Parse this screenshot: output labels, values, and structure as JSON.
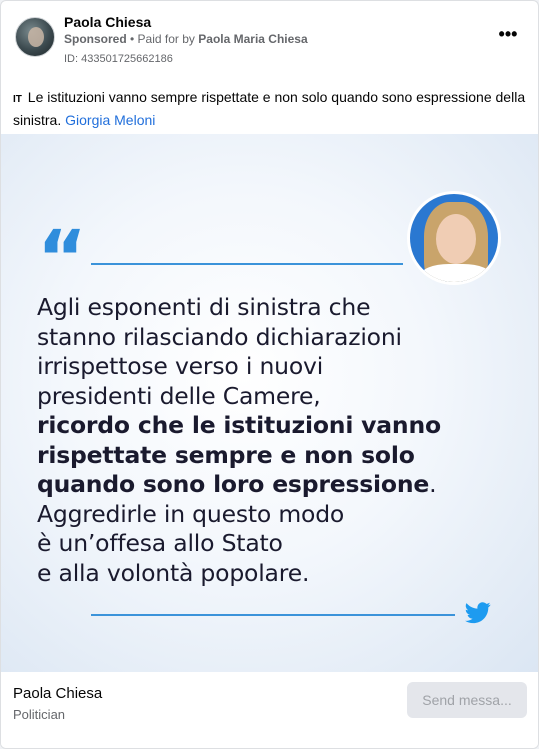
{
  "header": {
    "page_name": "Paola Chiesa",
    "sponsored_label": "Sponsored",
    "separator": " • ",
    "paid_for_text": "Paid for by",
    "payer_name": "Paola Maria Chiesa",
    "ad_id": "ID: 433501725662186",
    "more_label": "•••"
  },
  "caption": {
    "flag": "IT",
    "text": " Le istituzioni vanno sempre rispettate e non solo quando sono espressione della sinistra. ",
    "link_text": "Giorgia Meloni"
  },
  "creative": {
    "quote_mark": "“",
    "line1": "Agli esponenti di sinistra che",
    "line2": "stanno rilasciando dichiarazioni",
    "line3": "irrispettose verso i nuovi",
    "line4": "presidenti delle Camere,",
    "bold1": "ricordo che le istituzioni vanno",
    "bold2": "rispettate sempre e non solo",
    "bold3": "quando sono loro espressione",
    "bold3_tail": ".",
    "line5": "Aggredirle in questo modo",
    "line6": "è un’offesa allo Stato",
    "line7": "e alla volontà popolare.",
    "twitter_icon": "twitter-bird-icon",
    "accent_color": "#2f8ddc"
  },
  "footer": {
    "name": "Paola Chiesa",
    "category": "Politician",
    "cta_label": "Send messa..."
  }
}
